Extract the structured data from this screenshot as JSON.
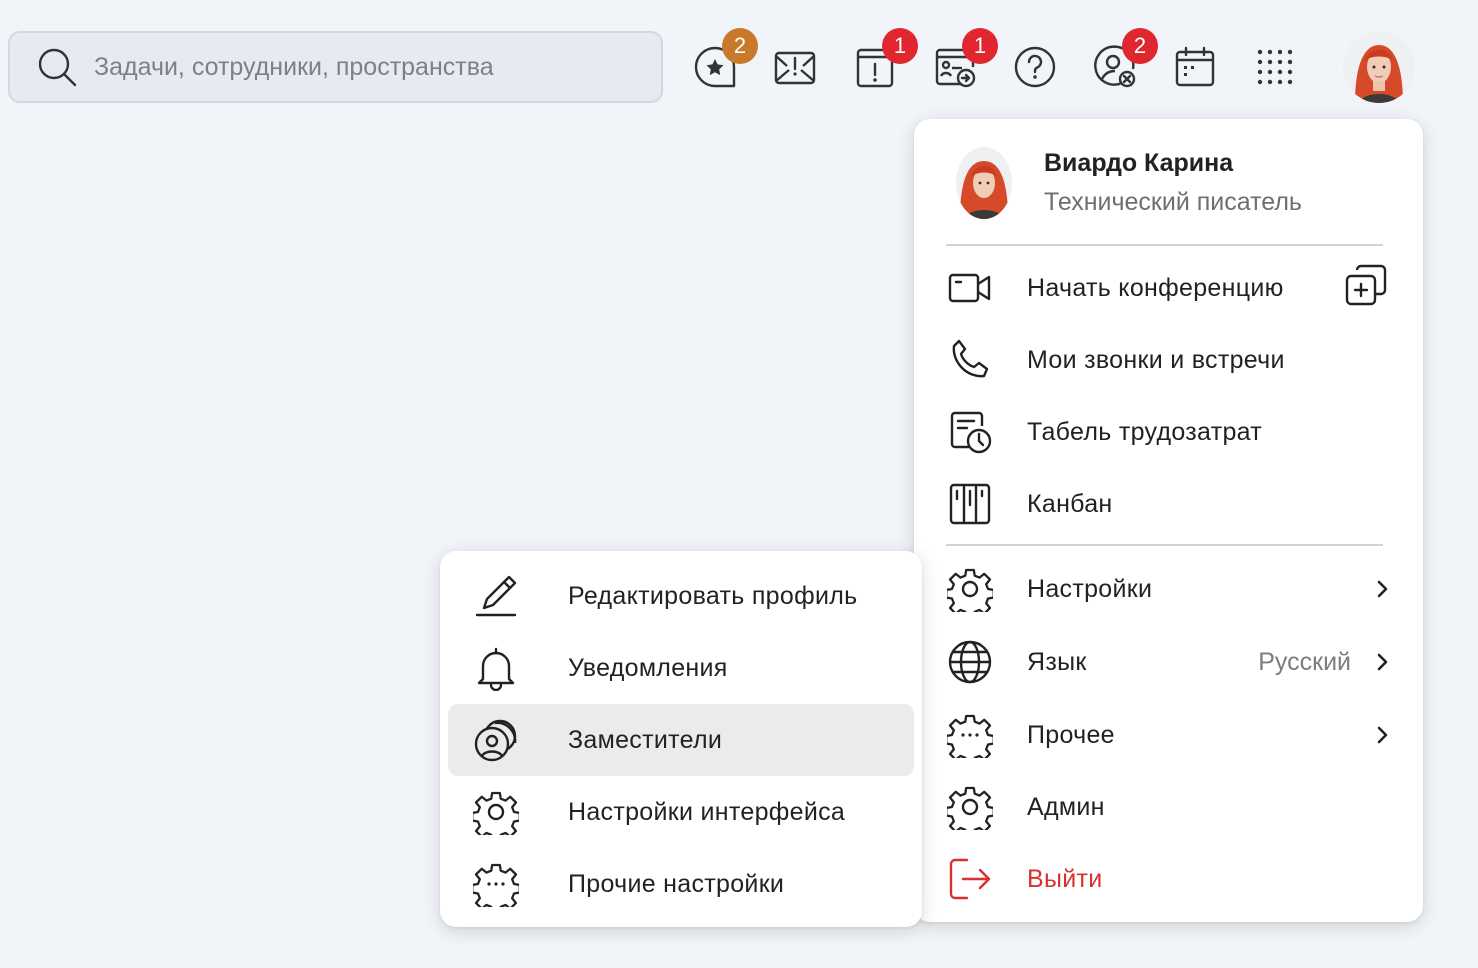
{
  "search": {
    "placeholder": "Задачи, сотрудники, пространства"
  },
  "topbar": {
    "icons": [
      {
        "name": "favorites-chat-icon",
        "badge": "2",
        "badge_color": "#c87a2a"
      },
      {
        "name": "mail-alert-icon",
        "badge": ""
      },
      {
        "name": "task-alert-icon",
        "badge": "1",
        "badge_color": "#e0262f"
      },
      {
        "name": "request-transfer-icon",
        "badge": "1",
        "badge_color": "#e0262f"
      },
      {
        "name": "help-icon",
        "badge": ""
      },
      {
        "name": "user-absence-icon",
        "badge": "2",
        "badge_color": "#e0262f"
      },
      {
        "name": "calendar-icon",
        "badge": ""
      },
      {
        "name": "apps-grid-icon",
        "badge": ""
      }
    ]
  },
  "user": {
    "name": "Виардо Карина",
    "role": "Технический писатель"
  },
  "main_menu": {
    "items": [
      {
        "label": "Начать конференцию",
        "icon": "video-icon"
      },
      {
        "label": "Мои звонки и встречи",
        "icon": "phone-icon"
      },
      {
        "label": "Табель трудозатрат",
        "icon": "timesheet-icon"
      },
      {
        "label": "Канбан",
        "icon": "kanban-icon"
      },
      {
        "label": "Настройки",
        "icon": "gear-icon"
      },
      {
        "label": "Язык",
        "icon": "globe-icon",
        "value": "Русский"
      },
      {
        "label": "Прочее",
        "icon": "gear-dots-icon"
      },
      {
        "label": "Админ",
        "icon": "gear-icon"
      },
      {
        "label": "Выйти",
        "icon": "logout-icon"
      }
    ]
  },
  "sub_menu": {
    "items": [
      {
        "label": "Редактировать профиль",
        "icon": "pen-icon"
      },
      {
        "label": "Уведомления",
        "icon": "bell-icon"
      },
      {
        "label": "Заместители",
        "icon": "deputies-icon",
        "active": true
      },
      {
        "label": "Настройки интерфейса",
        "icon": "gear-icon"
      },
      {
        "label": "Прочие настройки",
        "icon": "gear-dots-icon"
      }
    ]
  },
  "colors": {
    "background": "#f1f4f8",
    "danger": "#d8312f",
    "badge_red": "#e0262f",
    "badge_orange": "#c87a2a",
    "hover": "#ebebeb"
  }
}
